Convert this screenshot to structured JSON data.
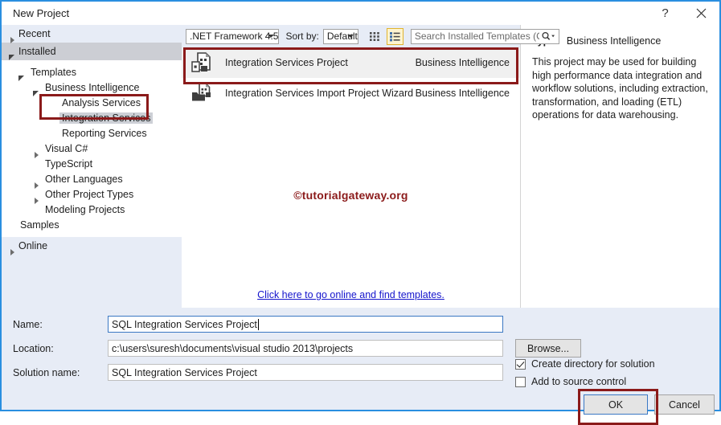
{
  "window": {
    "title": "New Project",
    "help_label": "?",
    "close_label": "✕"
  },
  "sidebar": {
    "recent": "Recent",
    "installed": "Installed",
    "online": "Online",
    "tree": [
      {
        "label": "Templates",
        "indent": 1,
        "state": "expanded"
      },
      {
        "label": "Business Intelligence",
        "indent": 2,
        "state": "expanded"
      },
      {
        "label": "Analysis Services",
        "indent": 3,
        "state": "none"
      },
      {
        "label": "Integration Services",
        "indent": 3,
        "state": "none",
        "active": true
      },
      {
        "label": "Reporting Services",
        "indent": 3,
        "state": "none"
      },
      {
        "label": "Visual C#",
        "indent": 2,
        "state": "collapsed"
      },
      {
        "label": "TypeScript",
        "indent": 2,
        "state": "none"
      },
      {
        "label": "Other Languages",
        "indent": 2,
        "state": "collapsed"
      },
      {
        "label": "Other Project Types",
        "indent": 2,
        "state": "collapsed"
      },
      {
        "label": "Modeling Projects",
        "indent": 2,
        "state": "none"
      },
      {
        "label": "Samples",
        "indent": 1,
        "state": "none"
      }
    ]
  },
  "toolbar": {
    "framework": ".NET Framework 4.5",
    "sort_by_label": "Sort by:",
    "sort_value": "Default",
    "grid_view_icon": "grid-view-icon",
    "list_view_icon": "list-view-icon",
    "search_placeholder": "Search Installed Templates (Ctrl+E)",
    "search_value": "",
    "search_icon": "search-icon"
  },
  "templates": {
    "items": [
      {
        "name": "Integration Services Project",
        "category": "Business Intelligence",
        "icon": "ssis-project-icon",
        "selected": true
      },
      {
        "name": "Integration Services Import Project Wizard",
        "category": "Business Intelligence",
        "icon": "ssis-import-wizard-icon",
        "selected": false
      }
    ],
    "watermark": "©tutorialgateway.org",
    "online_link": "Click here to go online and find templates."
  },
  "details": {
    "type_label": "Type:",
    "type_value": "Business Intelligence",
    "description": "This project may be used for building high performance data integration and workflow solutions, including extraction, transformation, and loading (ETL) operations for data warehousing."
  },
  "form": {
    "name_label": "Name:",
    "name_value": "SQL Integration Services Project",
    "location_label": "Location:",
    "location_value": "c:\\users\\suresh\\documents\\visual studio 2013\\projects",
    "solution_label": "Solution name:",
    "solution_value": "SQL Integration Services Project",
    "browse_label": "Browse...",
    "create_dir_label": "Create directory for solution",
    "create_dir_checked": true,
    "source_control_label": "Add to source control",
    "source_control_checked": false
  },
  "footer": {
    "ok_label": "OK",
    "cancel_label": "Cancel"
  },
  "colors": {
    "window_border": "#2a8fe0",
    "panel_bg": "#e7ecf6",
    "annotation": "#8b1a1a",
    "link": "#1414cc",
    "selected_row": "#f0f0f0"
  }
}
